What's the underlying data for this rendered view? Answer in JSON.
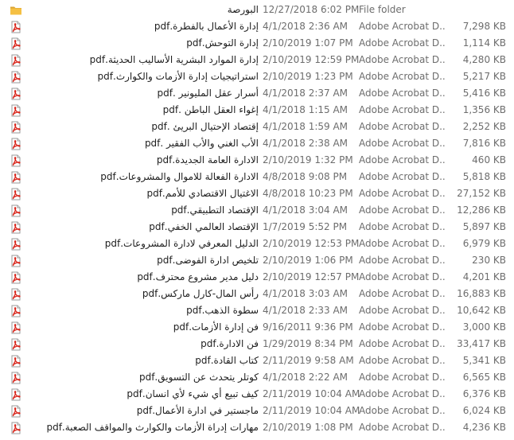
{
  "colors": {
    "folder": "#f5c043",
    "folder_dark": "#dba534",
    "pdf_red": "#d9261c",
    "text": "#1e1e1e",
    "meta_text": "#6d6d6d"
  },
  "rows": [
    {
      "name": "البورصة",
      "date": "12/27/2018 6:02 PM",
      "type": "File folder",
      "size": "",
      "icon": "folder-icon"
    },
    {
      "name": "إدارة الأعمال بالفطرة.pdf",
      "date": "4/1/2018 2:36 AM",
      "type": "Adobe Acrobat D...",
      "size": "7,298 KB",
      "icon": "pdf-icon"
    },
    {
      "name": "إدارة التوحش.pdf",
      "date": "2/10/2019 1:07 PM",
      "type": "Adobe Acrobat D...",
      "size": "1,114 KB",
      "icon": "pdf-icon"
    },
    {
      "name": "إدارة الموارد البشرية الأساليب الحديثة.pdf",
      "date": "2/10/2019 12:59 PM",
      "type": "Adobe Acrobat D...",
      "size": "4,280 KB",
      "icon": "pdf-icon"
    },
    {
      "name": "استراتيجيات إدارة الأزمات والكوارث.pdf",
      "date": "2/10/2019 1:23 PM",
      "type": "Adobe Acrobat D...",
      "size": "5,217 KB",
      "icon": "pdf-icon"
    },
    {
      "name": "أسرار عقل المليونير .pdf",
      "date": "4/1/2018 2:37 AM",
      "type": "Adobe Acrobat D...",
      "size": "5,416 KB",
      "icon": "pdf-icon"
    },
    {
      "name": "إغواء العقل الباطن .pdf",
      "date": "4/1/2018 1:15 AM",
      "type": "Adobe Acrobat D...",
      "size": "1,356 KB",
      "icon": "pdf-icon"
    },
    {
      "name": "إقتصاد الإحتيال البريئ .pdf",
      "date": "4/1/2018 1:59 AM",
      "type": "Adobe Acrobat D...",
      "size": "2,252 KB",
      "icon": "pdf-icon"
    },
    {
      "name": "الأب الغني والأب الفقير .pdf",
      "date": "4/1/2018 2:38 AM",
      "type": "Adobe Acrobat D...",
      "size": "7,816 KB",
      "icon": "pdf-icon"
    },
    {
      "name": "الادارة العامة الجديدة.pdf",
      "date": "2/10/2019 1:32 PM",
      "type": "Adobe Acrobat D...",
      "size": "460 KB",
      "icon": "pdf-icon"
    },
    {
      "name": "الادارة الفعالة للاموال والمشروعات.pdf",
      "date": "4/8/2018 9:08 PM",
      "type": "Adobe Acrobat D...",
      "size": "5,818 KB",
      "icon": "pdf-icon"
    },
    {
      "name": "الاغتيال الاقتصادي للأمم.pdf",
      "date": "4/8/2018 10:23 PM",
      "type": "Adobe Acrobat D...",
      "size": "27,152 KB",
      "icon": "pdf-icon"
    },
    {
      "name": "الإقتصاد التطبيقي.pdf",
      "date": "4/1/2018 3:04 AM",
      "type": "Adobe Acrobat D...",
      "size": "12,286 KB",
      "icon": "pdf-icon"
    },
    {
      "name": "الإقتصاد العالمي الخفي.pdf",
      "date": "1/7/2019 5:52 PM",
      "type": "Adobe Acrobat D...",
      "size": "5,897 KB",
      "icon": "pdf-icon"
    },
    {
      "name": "الدليل المعرفي لادارة المشروعات.pdf",
      "date": "2/10/2019 12:53 PM",
      "type": "Adobe Acrobat D...",
      "size": "6,979 KB",
      "icon": "pdf-icon"
    },
    {
      "name": "تلخيص ادارة الفوضى.pdf",
      "date": "2/10/2019 1:06 PM",
      "type": "Adobe Acrobat D...",
      "size": "230 KB",
      "icon": "pdf-icon"
    },
    {
      "name": "دليل مدير مشروع محترف.pdf",
      "date": "2/10/2019 12:57 PM",
      "type": "Adobe Acrobat D...",
      "size": "4,201 KB",
      "icon": "pdf-icon"
    },
    {
      "name": "رأس المال-كارل ماركس.pdf",
      "date": "4/1/2018 3:03 AM",
      "type": "Adobe Acrobat D...",
      "size": "16,883 KB",
      "icon": "pdf-icon"
    },
    {
      "name": "سطوة الذهب.pdf",
      "date": "4/1/2018 2:33 AM",
      "type": "Adobe Acrobat D...",
      "size": "10,642 KB",
      "icon": "pdf-icon"
    },
    {
      "name": "فن إدارة الأزمات.pdf",
      "date": "9/16/2011 9:36 PM",
      "type": "Adobe Acrobat D...",
      "size": "3,000 KB",
      "icon": "pdf-icon"
    },
    {
      "name": "فن الادارة.pdf",
      "date": "1/29/2019 8:34 PM",
      "type": "Adobe Acrobat D...",
      "size": "33,417 KB",
      "icon": "pdf-icon"
    },
    {
      "name": "كتاب القادة.pdf",
      "date": "2/11/2019 9:58 AM",
      "type": "Adobe Acrobat D...",
      "size": "5,341 KB",
      "icon": "pdf-icon"
    },
    {
      "name": "كوتلر يتحدث عن التسويق.pdf",
      "date": "4/1/2018 2:22 AM",
      "type": "Adobe Acrobat D...",
      "size": "6,565 KB",
      "icon": "pdf-icon"
    },
    {
      "name": "كيف تبيع أي شيء لأي انسان.pdf",
      "date": "2/11/2019 10:04 AM",
      "type": "Adobe Acrobat D...",
      "size": "6,376 KB",
      "icon": "pdf-icon"
    },
    {
      "name": "ماجستير في ادارة الأعمال.pdf",
      "date": "2/11/2019 10:04 AM",
      "type": "Adobe Acrobat D...",
      "size": "6,024 KB",
      "icon": "pdf-icon"
    },
    {
      "name": "مهارات إدراة الأزمات والكوارث والمواقف الصعبة.pdf",
      "date": "2/10/2019 1:08 PM",
      "type": "Adobe Acrobat D...",
      "size": "4,236 KB",
      "icon": "pdf-icon"
    }
  ]
}
